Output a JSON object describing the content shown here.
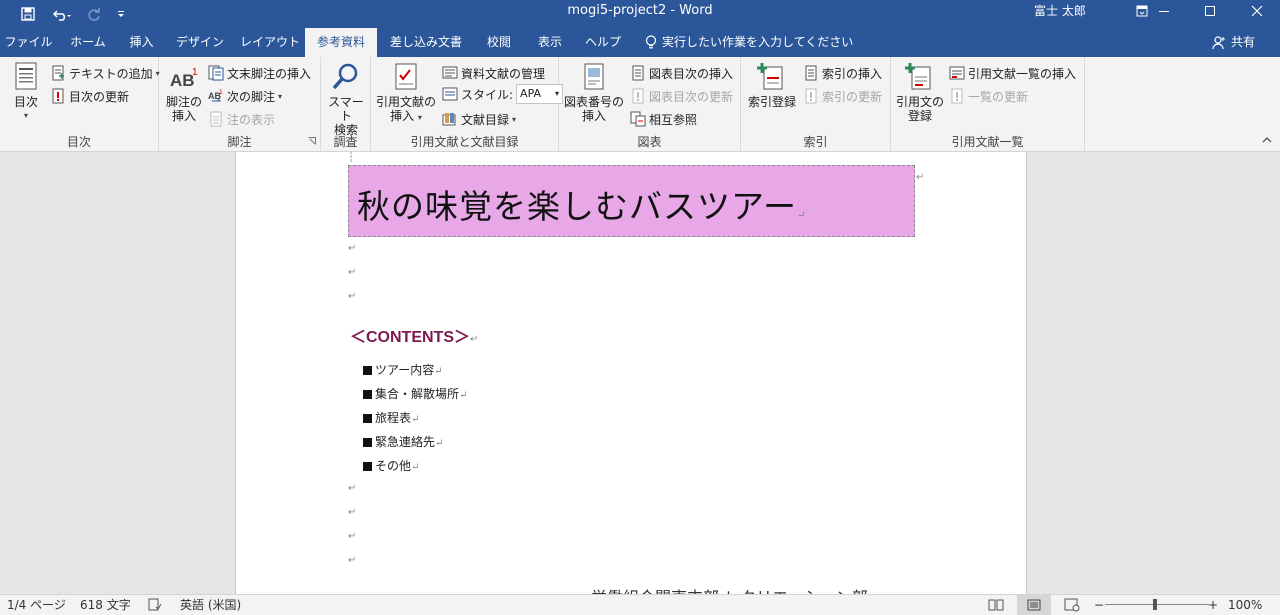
{
  "window": {
    "title": "mogi5-project2  -  Word",
    "user": "富士 太郎"
  },
  "tabs": [
    {
      "label": "ファイル"
    },
    {
      "label": "ホーム"
    },
    {
      "label": "挿入"
    },
    {
      "label": "デザイン"
    },
    {
      "label": "レイアウト"
    },
    {
      "label": "参考資料",
      "active": true
    },
    {
      "label": "差し込み文書"
    },
    {
      "label": "校閲"
    },
    {
      "label": "表示"
    },
    {
      "label": "ヘルプ"
    }
  ],
  "tell_me": "実行したい作業を入力してください",
  "share": "共有",
  "ribbon": {
    "toc": {
      "label": "目次",
      "toc_button": "目次",
      "add_text": "テキストの追加",
      "update_toc": "目次の更新"
    },
    "footnotes": {
      "label": "脚注",
      "insert_footnote": [
        "脚注の",
        "挿入"
      ],
      "insert_endnote": "文末脚注の挿入",
      "next_footnote": "次の脚注",
      "show_notes": "注の表示"
    },
    "research": {
      "label": "調査",
      "smart_lookup": [
        "スマート",
        "検索"
      ]
    },
    "citations": {
      "label": "引用文献と文献目録",
      "insert_citation": [
        "引用文献の",
        "挿入"
      ],
      "manage_sources": "資料文献の管理",
      "style_label": "スタイル:",
      "style_value": "APA",
      "bibliography": "文献目録"
    },
    "captions": {
      "label": "図表",
      "insert_caption": [
        "図表番号の",
        "挿入"
      ],
      "insert_table_of_figures": "図表目次の挿入",
      "update_table": "図表目次の更新",
      "cross_reference": "相互参照"
    },
    "index": {
      "label": "索引",
      "mark_entry": "索引登録",
      "insert_index": "索引の挿入",
      "update_index": "索引の更新"
    },
    "table_of_authorities": {
      "label": "引用文献一覧",
      "mark_citation": [
        "引用文の",
        "登録"
      ],
      "insert_table": "引用文献一覧の挿入",
      "update_table": "一覧の更新"
    }
  },
  "document": {
    "title": "秋の味覚を楽しむバスツアー",
    "contents_heading": "＜CONTENTS＞",
    "bullets": [
      "ツアー内容",
      "集合・解散場所",
      "旅程表",
      "緊急連絡先",
      "その他"
    ],
    "footer_partial": "労働組合関東支部 レクリエーション部"
  },
  "status": {
    "page": "1/4 ページ",
    "words": "618 文字",
    "language": "英語 (米国)",
    "zoom": "100%"
  },
  "colors": {
    "accent": "#2b579a",
    "title_box": "#e8a8e8",
    "contents_heading": "#7a1a4e"
  }
}
